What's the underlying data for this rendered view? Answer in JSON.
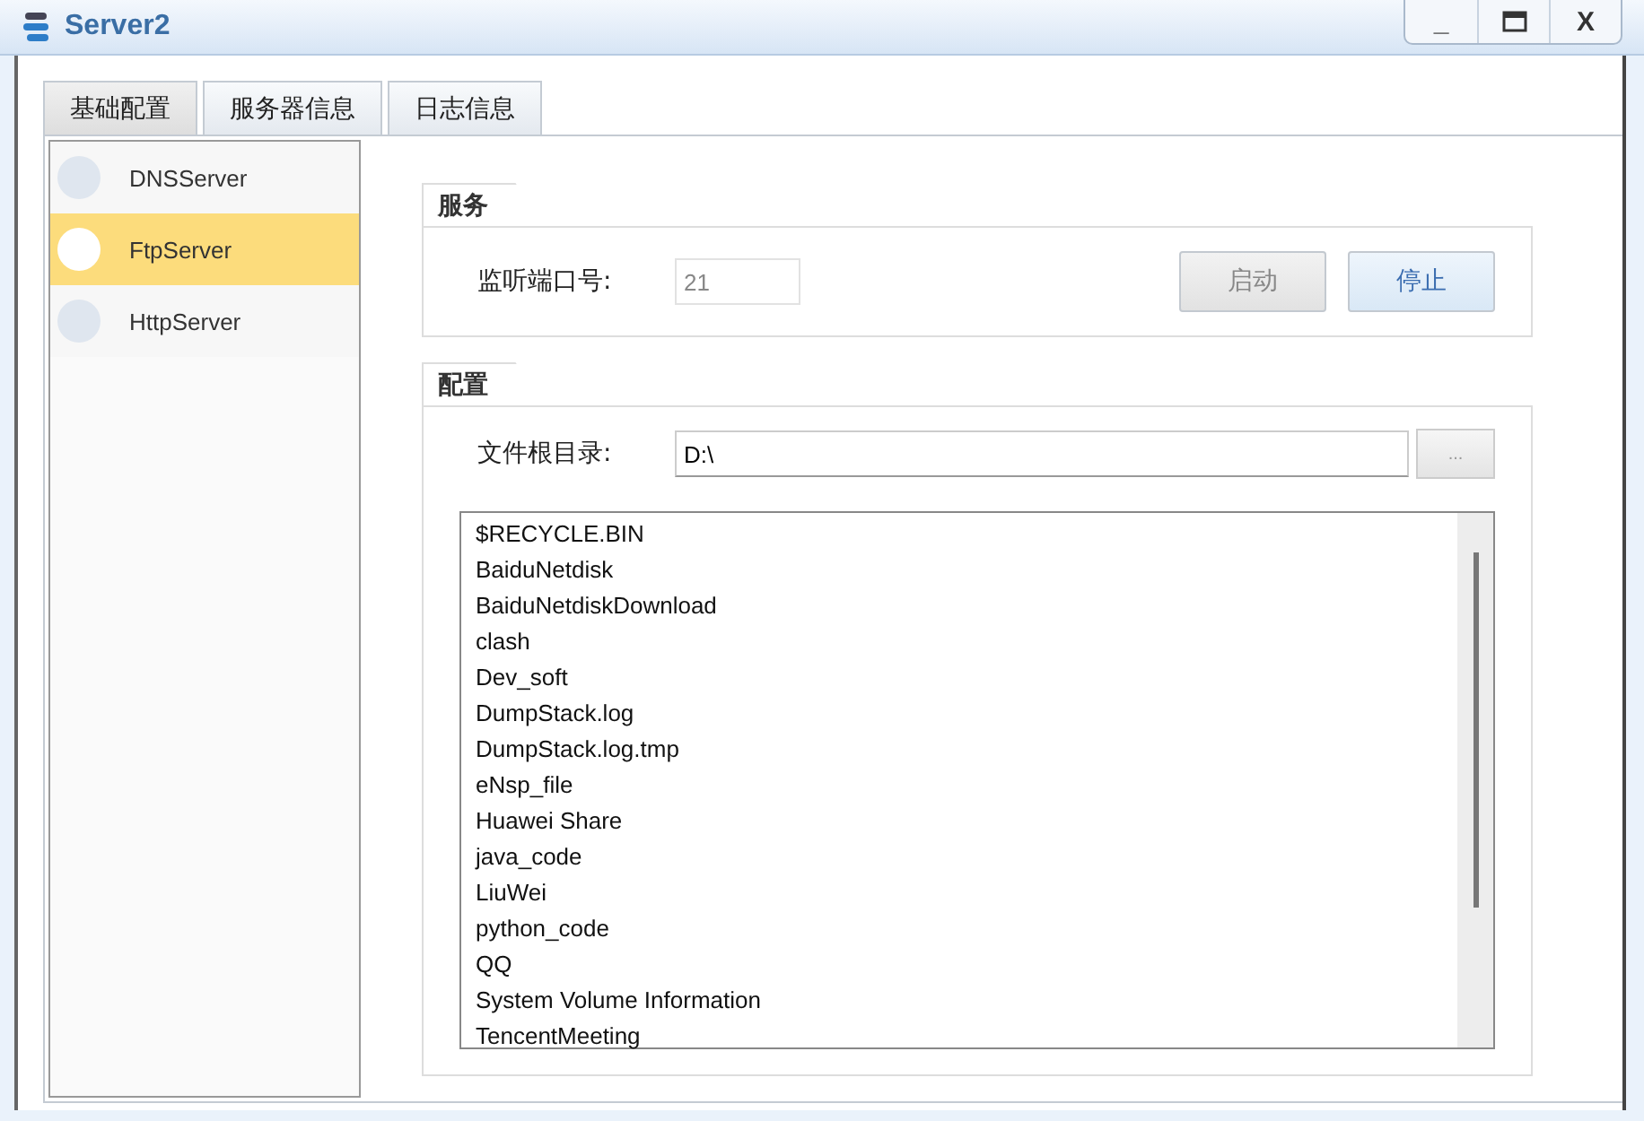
{
  "window": {
    "title": "Server2",
    "controls": [
      "_",
      "X"
    ]
  },
  "tabs": [
    {
      "label": "基础配置",
      "selected": true
    },
    {
      "label": "服务器信息",
      "selected": false
    },
    {
      "label": "日志信息",
      "selected": false
    }
  ],
  "servers": [
    {
      "name": "DNSServer",
      "selected": false
    },
    {
      "name": "FtpServer",
      "selected": true
    },
    {
      "name": "HttpServer",
      "selected": false
    }
  ],
  "service": {
    "title": "服务",
    "port_label": "监听端口号:",
    "port_value": "21",
    "buttons": [
      {
        "label": "启动",
        "disabled": true
      },
      {
        "label": "停止",
        "disabled": false
      }
    ]
  },
  "config": {
    "title": "配置",
    "root_label": "文件根目录:",
    "root_value": "D:\\",
    "browse": "...",
    "files": [
      "$RECYCLE.BIN",
      "BaiduNetdisk",
      "BaiduNetdiskDownload",
      "clash",
      "Dev_soft",
      "DumpStack.log",
      "DumpStack.log.tmp",
      "eNsp_file",
      "Huawei Share",
      "java_code",
      "LiuWei",
      "python_code",
      "QQ",
      "System Volume Information",
      "TencentMeeting"
    ]
  }
}
